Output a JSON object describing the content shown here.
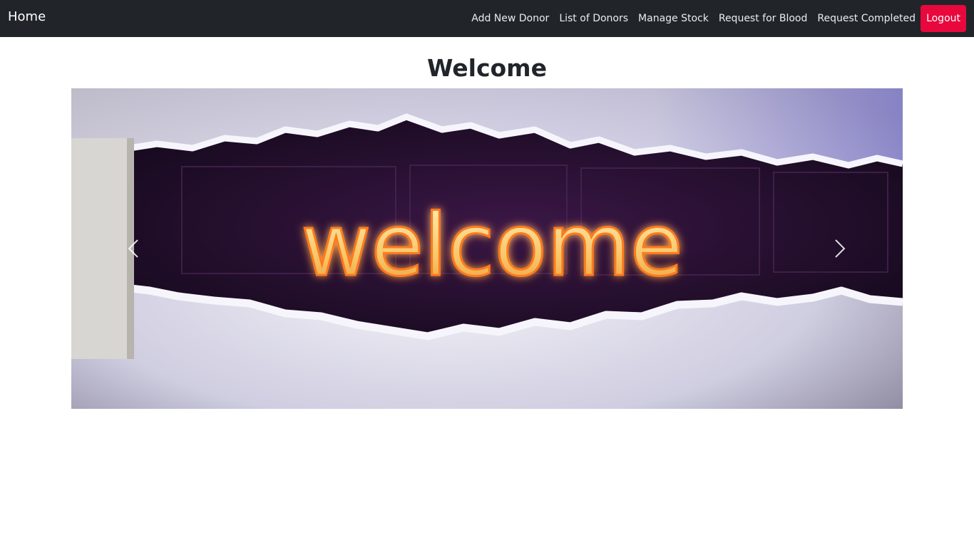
{
  "navbar": {
    "brand": "Home",
    "links": [
      {
        "label": "Add New Donor"
      },
      {
        "label": "List of Donors"
      },
      {
        "label": "Manage Stock"
      },
      {
        "label": "Request for Blood"
      },
      {
        "label": "Request Completed"
      }
    ],
    "logout_label": "Logout",
    "logout_color": "#e8083e",
    "background_color": "#212529"
  },
  "main": {
    "title": "Welcome"
  },
  "carousel": {
    "slide_text": "welcome",
    "prev_icon": "chevron-left-icon",
    "next_icon": "chevron-right-icon"
  }
}
